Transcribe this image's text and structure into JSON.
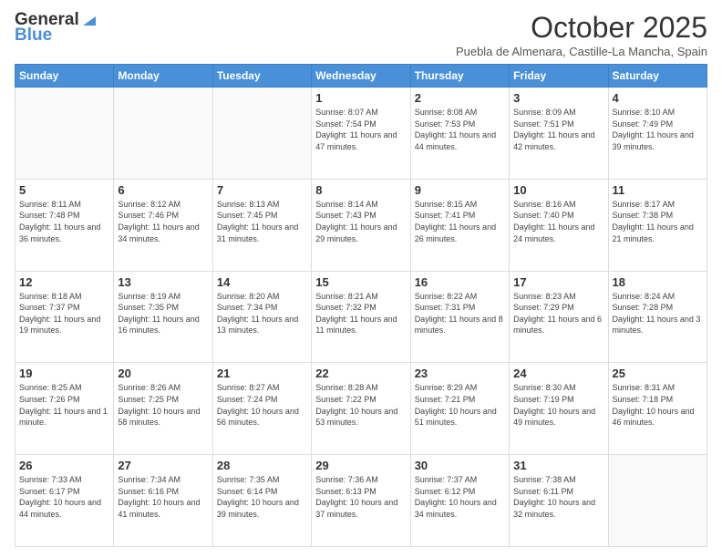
{
  "logo": {
    "general": "General",
    "blue": "Blue"
  },
  "title": "October 2025",
  "subtitle": "Puebla de Almenara, Castille-La Mancha, Spain",
  "days_of_week": [
    "Sunday",
    "Monday",
    "Tuesday",
    "Wednesday",
    "Thursday",
    "Friday",
    "Saturday"
  ],
  "weeks": [
    [
      {
        "day": "",
        "info": ""
      },
      {
        "day": "",
        "info": ""
      },
      {
        "day": "",
        "info": ""
      },
      {
        "day": "1",
        "info": "Sunrise: 8:07 AM\nSunset: 7:54 PM\nDaylight: 11 hours and 47 minutes."
      },
      {
        "day": "2",
        "info": "Sunrise: 8:08 AM\nSunset: 7:53 PM\nDaylight: 11 hours and 44 minutes."
      },
      {
        "day": "3",
        "info": "Sunrise: 8:09 AM\nSunset: 7:51 PM\nDaylight: 11 hours and 42 minutes."
      },
      {
        "day": "4",
        "info": "Sunrise: 8:10 AM\nSunset: 7:49 PM\nDaylight: 11 hours and 39 minutes."
      }
    ],
    [
      {
        "day": "5",
        "info": "Sunrise: 8:11 AM\nSunset: 7:48 PM\nDaylight: 11 hours and 36 minutes."
      },
      {
        "day": "6",
        "info": "Sunrise: 8:12 AM\nSunset: 7:46 PM\nDaylight: 11 hours and 34 minutes."
      },
      {
        "day": "7",
        "info": "Sunrise: 8:13 AM\nSunset: 7:45 PM\nDaylight: 11 hours and 31 minutes."
      },
      {
        "day": "8",
        "info": "Sunrise: 8:14 AM\nSunset: 7:43 PM\nDaylight: 11 hours and 29 minutes."
      },
      {
        "day": "9",
        "info": "Sunrise: 8:15 AM\nSunset: 7:41 PM\nDaylight: 11 hours and 26 minutes."
      },
      {
        "day": "10",
        "info": "Sunrise: 8:16 AM\nSunset: 7:40 PM\nDaylight: 11 hours and 24 minutes."
      },
      {
        "day": "11",
        "info": "Sunrise: 8:17 AM\nSunset: 7:38 PM\nDaylight: 11 hours and 21 minutes."
      }
    ],
    [
      {
        "day": "12",
        "info": "Sunrise: 8:18 AM\nSunset: 7:37 PM\nDaylight: 11 hours and 19 minutes."
      },
      {
        "day": "13",
        "info": "Sunrise: 8:19 AM\nSunset: 7:35 PM\nDaylight: 11 hours and 16 minutes."
      },
      {
        "day": "14",
        "info": "Sunrise: 8:20 AM\nSunset: 7:34 PM\nDaylight: 11 hours and 13 minutes."
      },
      {
        "day": "15",
        "info": "Sunrise: 8:21 AM\nSunset: 7:32 PM\nDaylight: 11 hours and 11 minutes."
      },
      {
        "day": "16",
        "info": "Sunrise: 8:22 AM\nSunset: 7:31 PM\nDaylight: 11 hours and 8 minutes."
      },
      {
        "day": "17",
        "info": "Sunrise: 8:23 AM\nSunset: 7:29 PM\nDaylight: 11 hours and 6 minutes."
      },
      {
        "day": "18",
        "info": "Sunrise: 8:24 AM\nSunset: 7:28 PM\nDaylight: 11 hours and 3 minutes."
      }
    ],
    [
      {
        "day": "19",
        "info": "Sunrise: 8:25 AM\nSunset: 7:26 PM\nDaylight: 11 hours and 1 minute."
      },
      {
        "day": "20",
        "info": "Sunrise: 8:26 AM\nSunset: 7:25 PM\nDaylight: 10 hours and 58 minutes."
      },
      {
        "day": "21",
        "info": "Sunrise: 8:27 AM\nSunset: 7:24 PM\nDaylight: 10 hours and 56 minutes."
      },
      {
        "day": "22",
        "info": "Sunrise: 8:28 AM\nSunset: 7:22 PM\nDaylight: 10 hours and 53 minutes."
      },
      {
        "day": "23",
        "info": "Sunrise: 8:29 AM\nSunset: 7:21 PM\nDaylight: 10 hours and 51 minutes."
      },
      {
        "day": "24",
        "info": "Sunrise: 8:30 AM\nSunset: 7:19 PM\nDaylight: 10 hours and 49 minutes."
      },
      {
        "day": "25",
        "info": "Sunrise: 8:31 AM\nSunset: 7:18 PM\nDaylight: 10 hours and 46 minutes."
      }
    ],
    [
      {
        "day": "26",
        "info": "Sunrise: 7:33 AM\nSunset: 6:17 PM\nDaylight: 10 hours and 44 minutes."
      },
      {
        "day": "27",
        "info": "Sunrise: 7:34 AM\nSunset: 6:16 PM\nDaylight: 10 hours and 41 minutes."
      },
      {
        "day": "28",
        "info": "Sunrise: 7:35 AM\nSunset: 6:14 PM\nDaylight: 10 hours and 39 minutes."
      },
      {
        "day": "29",
        "info": "Sunrise: 7:36 AM\nSunset: 6:13 PM\nDaylight: 10 hours and 37 minutes."
      },
      {
        "day": "30",
        "info": "Sunrise: 7:37 AM\nSunset: 6:12 PM\nDaylight: 10 hours and 34 minutes."
      },
      {
        "day": "31",
        "info": "Sunrise: 7:38 AM\nSunset: 6:11 PM\nDaylight: 10 hours and 32 minutes."
      },
      {
        "day": "",
        "info": ""
      }
    ]
  ]
}
